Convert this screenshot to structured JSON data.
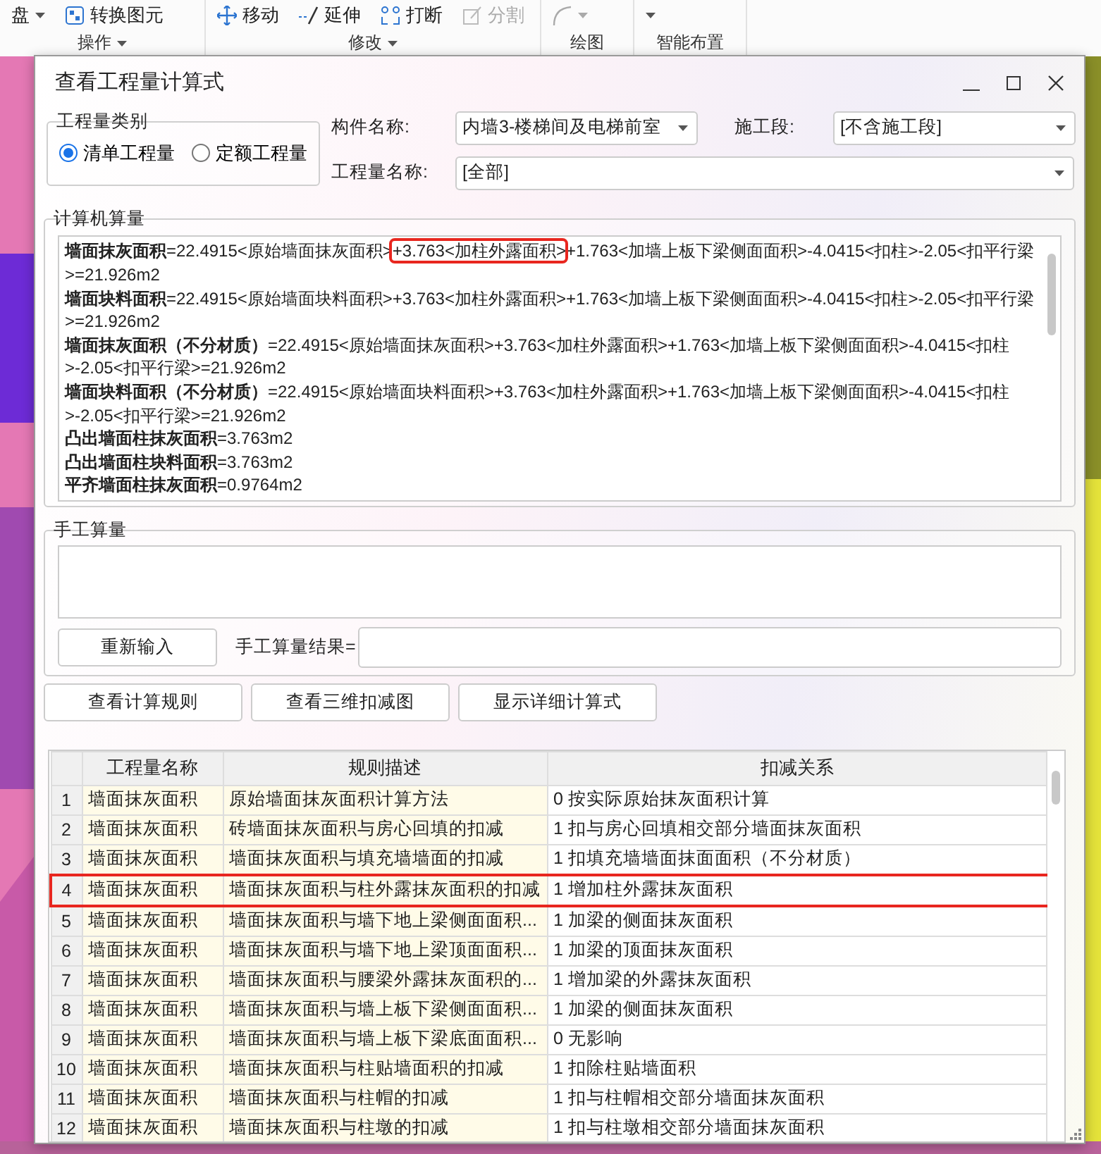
{
  "ribbon": {
    "groups": [
      {
        "label": "操作",
        "tools": [
          {
            "text": "盘",
            "disabled": false
          },
          {
            "text": "转换图元",
            "disabled": false
          }
        ]
      },
      {
        "label": "修改",
        "tools": [
          {
            "text": "移动",
            "disabled": false
          },
          {
            "text": "延伸",
            "disabled": false
          },
          {
            "text": "打断",
            "disabled": false
          },
          {
            "text": "分割",
            "disabled": true
          }
        ]
      },
      {
        "label": "绘图"
      },
      {
        "label": "智能布置"
      }
    ]
  },
  "dialog": {
    "title": "查看工程量计算式",
    "category": {
      "title": "工程量类别",
      "options": [
        {
          "label": "清单工程量",
          "selected": true
        },
        {
          "label": "定额工程量",
          "selected": false
        }
      ]
    },
    "fields": [
      {
        "label": "构件名称:",
        "value": "内墙3-楼梯间及电梯前室"
      },
      {
        "label": "施工段:",
        "value": "[不含施工段]"
      },
      {
        "label": "工程量名称:",
        "value": "[全部]"
      }
    ],
    "computed": {
      "title": "计算机算量",
      "lines": [
        {
          "label": "墙面抹灰面积",
          "parts": [
            {
              "text": "=22.4915<原始墙面抹灰面积>",
              "highlight": false
            },
            {
              "text": "+3.763<加柱外露面积>",
              "highlight": true
            },
            {
              "text": "+1.763<加墙上板下梁侧面面积>-4.0415<扣柱>-2.05<扣平行梁>=21.926m2",
              "highlight": false
            }
          ]
        },
        {
          "label": "墙面块料面积",
          "parts": [
            {
              "text": "=22.4915<原始墙面块料面积>+3.763<加柱外露面积>+1.763<加墙上板下梁侧面面积>-4.0415<扣柱>-2.05<扣平行梁>=21.926m2",
              "highlight": false
            }
          ]
        },
        {
          "label": "墙面抹灰面积（不分材质）",
          "parts": [
            {
              "text": "=22.4915<原始墙面抹灰面积>+3.763<加柱外露面积>+1.763<加墙上板下梁侧面面积>-4.0415<扣柱>-2.05<扣平行梁>=21.926m2",
              "highlight": false
            }
          ]
        },
        {
          "label": "墙面块料面积（不分材质）",
          "parts": [
            {
              "text": "=22.4915<原始墙面块料面积>+3.763<加柱外露面积>+1.763<加墙上板下梁侧面面积>-4.0415<扣柱>-2.05<扣平行梁>=21.926m2",
              "highlight": false
            }
          ]
        },
        {
          "label": "凸出墙面柱抹灰面积",
          "parts": [
            {
              "text": "=3.763m2",
              "highlight": false
            }
          ]
        },
        {
          "label": "凸出墙面柱块料面积",
          "parts": [
            {
              "text": "=3.763m2",
              "highlight": false
            }
          ]
        },
        {
          "label": "平齐墙面柱抹灰面积",
          "parts": [
            {
              "text": "=0.9764m2",
              "highlight": false
            }
          ]
        }
      ]
    },
    "manual": {
      "title": "手工算量",
      "reset_button": "重新输入",
      "result_label": "手工算量结果="
    },
    "buttons": [
      "查看计算规则",
      "查看三维扣减图",
      "显示详细计算式"
    ],
    "table": {
      "columns": [
        "工程量名称",
        "规则描述",
        "扣减关系"
      ],
      "rows": [
        {
          "no": "1",
          "name": "墙面抹灰面积",
          "rule": "原始墙面抹灰面积计算方法",
          "relation": "0 按实际原始抹灰面积计算",
          "highlight": false
        },
        {
          "no": "2",
          "name": "墙面抹灰面积",
          "rule": "砖墙面抹灰面积与房心回填的扣减",
          "relation": "1 扣与房心回填相交部分墙面抹灰面积",
          "highlight": false
        },
        {
          "no": "3",
          "name": "墙面抹灰面积",
          "rule": "墙面抹灰面积与填充墙墙面的扣减",
          "relation": "1 扣填充墙墙面抹面面积（不分材质）",
          "highlight": false
        },
        {
          "no": "4",
          "name": "墙面抹灰面积",
          "rule": "墙面抹灰面积与柱外露抹灰面积的扣减",
          "relation": "1 增加柱外露抹灰面积",
          "highlight": true
        },
        {
          "no": "5",
          "name": "墙面抹灰面积",
          "rule": "墙面抹灰面积与墙下地上梁侧面面积...",
          "relation": "1 加梁的侧面抹灰面积",
          "highlight": false
        },
        {
          "no": "6",
          "name": "墙面抹灰面积",
          "rule": "墙面抹灰面积与墙下地上梁顶面面积...",
          "relation": "1 加梁的顶面抹灰面积",
          "highlight": false
        },
        {
          "no": "7",
          "name": "墙面抹灰面积",
          "rule": "墙面抹灰面积与腰梁外露抹灰面积的...",
          "relation": "1 增加梁的外露抹灰面积",
          "highlight": false
        },
        {
          "no": "8",
          "name": "墙面抹灰面积",
          "rule": "墙面抹灰面积与墙上板下梁侧面面积...",
          "relation": "1 加梁的侧面抹灰面积",
          "highlight": false
        },
        {
          "no": "9",
          "name": "墙面抹灰面积",
          "rule": "墙面抹灰面积与墙上板下梁底面面积...",
          "relation": "0  无影响",
          "highlight": false
        },
        {
          "no": "10",
          "name": "墙面抹灰面积",
          "rule": "墙面抹灰面积与柱贴墙面积的扣减",
          "relation": "1 扣除柱贴墙面积",
          "highlight": false
        },
        {
          "no": "11",
          "name": "墙面抹灰面积",
          "rule": "墙面抹灰面积与柱帽的扣减",
          "relation": "1 扣与柱帽相交部分墙面抹灰面积",
          "highlight": false
        },
        {
          "no": "12",
          "name": "墙面抹灰面积",
          "rule": "墙面抹灰面积与柱墩的扣减",
          "relation": "1 扣与柱墩相交部分墙面抹灰面积",
          "highlight": false
        }
      ]
    }
  }
}
